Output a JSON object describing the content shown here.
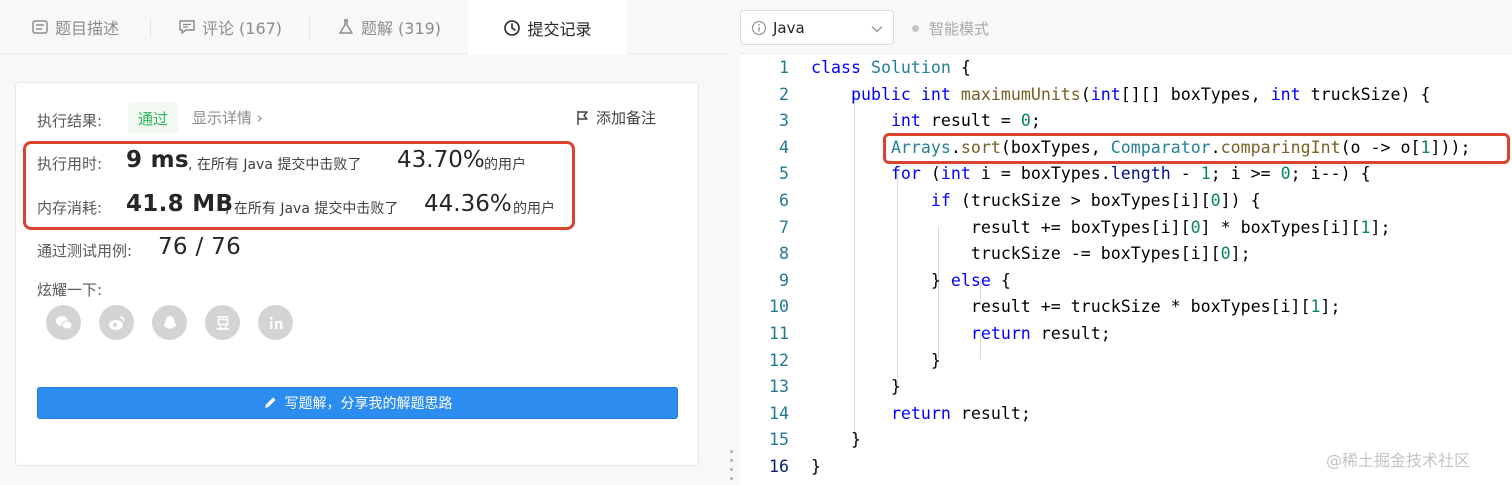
{
  "tabs": [
    {
      "label": "题目描述",
      "icon": "description-icon"
    },
    {
      "label": "评论 (167)",
      "icon": "comment-icon"
    },
    {
      "label": "题解 (319)",
      "icon": "flask-icon"
    },
    {
      "label": "提交记录",
      "icon": "clock-icon",
      "active": true
    }
  ],
  "result": {
    "label": "执行结果:",
    "status": "通过",
    "detail_link": "显示详情 ›",
    "note_button": "添加备注"
  },
  "stats": {
    "runtime_label": "执行用时:",
    "runtime_value": "9 ms",
    "runtime_text": ", 在所有 Java 提交中击败了",
    "runtime_pct": "43.70%",
    "runtime_suffix": "的用户",
    "memory_label": "内存消耗:",
    "memory_value": "41.8 MB",
    "memory_text": ", 在所有 Java 提交中击败了",
    "memory_pct": "44.36%",
    "memory_suffix": "的用户",
    "tests_label": "通过测试用例:",
    "tests_value": "76 / 76"
  },
  "share": {
    "label": "炫耀一下:",
    "icons": [
      "wechat-icon",
      "weibo-icon",
      "qq-icon",
      "douban-icon",
      "linkedin-icon"
    ]
  },
  "write_solution_button": "写题解，分享我的解题思路",
  "editor": {
    "language": "Java",
    "smart_mode": "智能模式",
    "line_numbers": [
      "1",
      "2",
      "3",
      "4",
      "5",
      "6",
      "7",
      "8",
      "9",
      "10",
      "11",
      "12",
      "13",
      "14",
      "15",
      "16"
    ],
    "code_lines": [
      "class Solution {",
      "    public int maximumUnits(int[][] boxTypes, int truckSize) {",
      "        int result = 0;",
      "        Arrays.sort(boxTypes, Comparator.comparingInt(o -> o[1]));",
      "        for (int i = boxTypes.length - 1; i >= 0; i--) {",
      "            if (truckSize > boxTypes[i][0]) {",
      "                result += boxTypes[i][0] * boxTypes[i][1];",
      "                truckSize -= boxTypes[i][0];",
      "            } else {",
      "                result += truckSize * boxTypes[i][1];",
      "                return result;",
      "            }",
      "        }",
      "        return result;",
      "    }",
      "}"
    ]
  },
  "watermark": "@稀土掘金技术社区"
}
